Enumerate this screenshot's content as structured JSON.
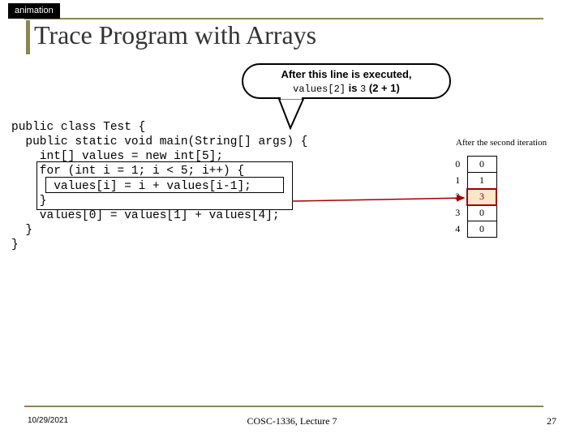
{
  "tag": "animation",
  "title": "Trace Program with Arrays",
  "callout": {
    "line1": "After this line is executed,",
    "line2_a": "values[2]",
    "line2_b": " is ",
    "line2_c": "3",
    "line2_d": " (2 ",
    "line2_e": "+ ",
    "line2_f": "1)"
  },
  "code": "public class Test {\n  public static void main(String[] args) {\n    int[] values = new int[5];\n    for (int i = 1; i < 5; i++) {\n      values[i] = i + values[i-1];\n    }\n    values[0] = values[1] + values[4];\n  }\n}",
  "array_caption": "After the second iteration",
  "array": {
    "rows": [
      {
        "idx": "0",
        "val": "0",
        "hl": false
      },
      {
        "idx": "1",
        "val": "1",
        "hl": false
      },
      {
        "idx": "2",
        "val": "3",
        "hl": true
      },
      {
        "idx": "3",
        "val": "0",
        "hl": false
      },
      {
        "idx": "4",
        "val": "0",
        "hl": false
      }
    ]
  },
  "footer": {
    "date": "10/29/2021",
    "center": "COSC-1336, Lecture 7",
    "page": "27"
  }
}
